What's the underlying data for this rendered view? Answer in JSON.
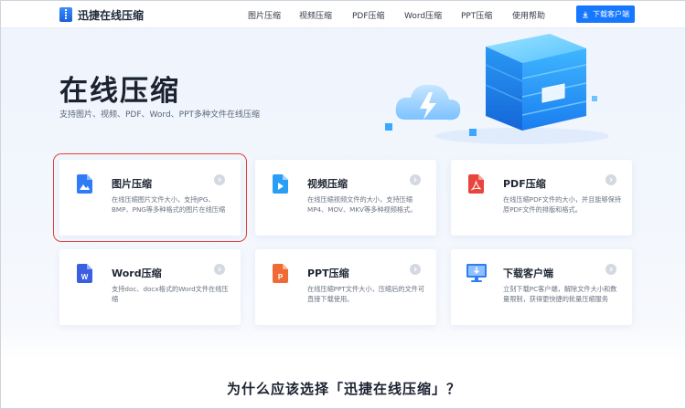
{
  "header": {
    "logo_text": "迅捷在线压缩",
    "nav": [
      {
        "label": "图片压缩"
      },
      {
        "label": "视频压缩"
      },
      {
        "label": "PDF压缩"
      },
      {
        "label": "Word压缩"
      },
      {
        "label": "PPT压缩"
      },
      {
        "label": "使用帮助"
      }
    ],
    "download_label": "下载客户端"
  },
  "hero": {
    "title": "在线压缩",
    "subtitle": "支持图片、视频、PDF、Word、PPT多种文件在线压缩"
  },
  "cards": [
    {
      "title": "图片压缩",
      "desc": "在线压缩图片文件大小，支持JPG、BMP、PNG等多种格式的图片在线压缩",
      "icon": "image-file-icon",
      "color": "#2f7cf6"
    },
    {
      "title": "视频压缩",
      "desc": "在线压缩视频文件的大小，支持压缩MP4、MOV、MKV等多种视频格式。",
      "icon": "video-file-icon",
      "color": "#2a9df4"
    },
    {
      "title": "PDF压缩",
      "desc": "在线压缩PDF文件的大小，并且能够保持原PDF文件的排版和格式。",
      "icon": "pdf-file-icon",
      "color": "#e8453c"
    },
    {
      "title": "Word压缩",
      "desc": "支持doc、docx格式的Word文件在线压缩",
      "icon": "word-file-icon",
      "color": "#3b5fe0"
    },
    {
      "title": "PPT压缩",
      "desc": "在线压缩PPT文件大小，压缩后的文件可直接下载使用。",
      "icon": "ppt-file-icon",
      "color": "#f06a35"
    },
    {
      "title": "下载客户端",
      "desc": "立刻下载PC客户端，解除文件大小和数量限制，获得更快捷的批量压缩服务",
      "icon": "monitor-download-icon",
      "color": "#2f7cf6"
    }
  ],
  "bottom": {
    "title": "为什么应该选择「迅捷在线压缩」？"
  },
  "colors": {
    "accent": "#1677ff",
    "selection_outline": "#e0423a"
  }
}
